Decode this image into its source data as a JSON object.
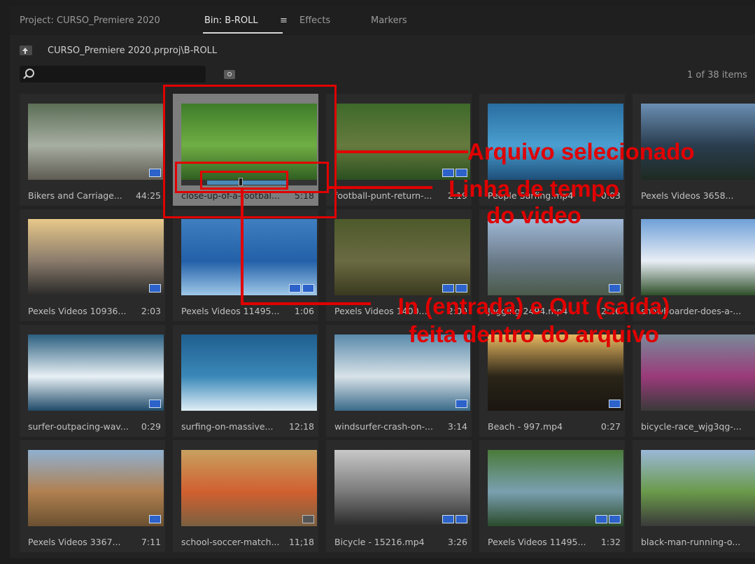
{
  "tabs": {
    "project": "Project: CURSO_Premiere 2020",
    "bin": "Bin: B-ROLL",
    "menu_glyph": "≡",
    "effects": "Effects",
    "markers": "Markers"
  },
  "path": "CURSO_Premiere 2020.prproj\\B-ROLL",
  "search": {
    "placeholder": "",
    "value": ""
  },
  "item_count": "1 of 38 items",
  "items": [
    {
      "label": "Bikers and Carriage...",
      "duration": "44:25",
      "colors": [
        "#5b6f56",
        "#a7aea2",
        "#5e5b52"
      ],
      "badges": [
        "audio"
      ]
    },
    {
      "label": "close-up-of-a-footbal...",
      "duration": "5:18",
      "colors": [
        "#3f7c2a",
        "#6fae44",
        "#315f21"
      ],
      "badges": []
    },
    {
      "label": "football-punt-return-...",
      "duration": "2:19",
      "colors": [
        "#3e6a2a",
        "#667a3e",
        "#2b5020"
      ],
      "badges": [
        "video",
        "audio"
      ]
    },
    {
      "label": "People Surfing.mp4",
      "duration": "0:03",
      "colors": [
        "#2a6ea0",
        "#4a9fd0",
        "#1e4f7a"
      ],
      "badges": []
    },
    {
      "label": "Pexels Videos 3658...",
      "duration": "",
      "colors": [
        "#6b8fb3",
        "#2a3d4f",
        "#1e2a22"
      ],
      "badges": []
    },
    {
      "label": "Pexels Videos 10936...",
      "duration": "2:03",
      "colors": [
        "#e8c98a",
        "#8a7b6b",
        "#2a2a2a"
      ],
      "badges": [
        "video"
      ]
    },
    {
      "label": "Pexels Videos 11495...",
      "duration": "1:06",
      "colors": [
        "#3f7fc0",
        "#2360a8",
        "#9fc8e8"
      ],
      "badges": [
        "video",
        "audio"
      ]
    },
    {
      "label": "Pexels Videos 1400...",
      "duration": "2:00",
      "colors": [
        "#4d5a2a",
        "#6a6a42",
        "#3a3a20"
      ],
      "badges": [
        "video",
        "audio"
      ]
    },
    {
      "label": "Jogging 2494.mp4",
      "duration": "2:16",
      "colors": [
        "#9fb8d6",
        "#6a7a88",
        "#4a5a4a"
      ],
      "badges": [
        "video"
      ]
    },
    {
      "label": "snowboarder-does-a-...",
      "duration": "",
      "colors": [
        "#6fa0d8",
        "#e8eef5",
        "#2f4f2a"
      ],
      "badges": []
    },
    {
      "label": "surfer-outpacing-wav...",
      "duration": "0:29",
      "colors": [
        "#2b5f7f",
        "#e8f0f5",
        "#1f4a68"
      ],
      "badges": [
        "video"
      ]
    },
    {
      "label": "surfing-on-massive...",
      "duration": "12:18",
      "colors": [
        "#1f5f8f",
        "#3a88b8",
        "#e0eef6"
      ],
      "badges": []
    },
    {
      "label": "windsurfer-crash-on-...",
      "duration": "3:14",
      "colors": [
        "#5a8aaa",
        "#d8e2e8",
        "#3a6a8a"
      ],
      "badges": [
        "video"
      ]
    },
    {
      "label": "Beach - 997.mp4",
      "duration": "0:27",
      "colors": [
        "#e8b860",
        "#2a2418",
        "#1a1610"
      ],
      "badges": [
        "video"
      ]
    },
    {
      "label": "bicycle-race_wjg3qg-...",
      "duration": "",
      "colors": [
        "#7a8a9a",
        "#9a3a7a",
        "#3a3a3a"
      ],
      "badges": []
    },
    {
      "label": "Pexels Videos 3367...",
      "duration": "7:11",
      "colors": [
        "#8fb0d0",
        "#b08050",
        "#6a5030"
      ],
      "badges": [
        "video"
      ]
    },
    {
      "label": "school-soccer-match...",
      "duration": "11;18",
      "colors": [
        "#c8a060",
        "#d06030",
        "#7a6040"
      ],
      "badges": [
        "dim"
      ]
    },
    {
      "label": "Bicycle - 15216.mp4",
      "duration": "3:26",
      "colors": [
        "#c8c8c8",
        "#7a7a7a",
        "#2a2a2a"
      ],
      "badges": [
        "video",
        "audio"
      ]
    },
    {
      "label": "Pexels Videos 11495...",
      "duration": "1:32",
      "colors": [
        "#4a7a3a",
        "#7aa0b0",
        "#2a4a2a"
      ],
      "badges": [
        "video",
        "audio"
      ]
    },
    {
      "label": "black-man-running-o...",
      "duration": "",
      "colors": [
        "#9ab8d8",
        "#6a9a4a",
        "#3a3a3a"
      ],
      "badges": []
    }
  ],
  "selected_scrub": {
    "in_fraction": 0.19,
    "out_fraction": 0.78,
    "playhead_fraction": 0.44
  },
  "annotations": {
    "selected": "Arquivo selecionado",
    "timeline_line1": "Linha de tempo",
    "timeline_line2": "do video",
    "inout_line1": "In (entrada) e Out (saída)",
    "inout_line2": "feita dentro do arquivo",
    "color": "#e10000"
  }
}
